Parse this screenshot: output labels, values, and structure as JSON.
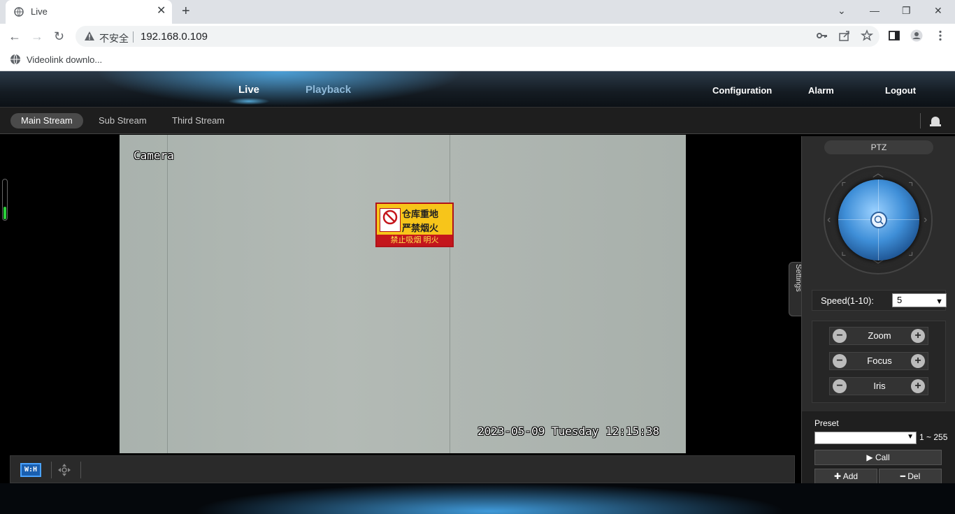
{
  "browser": {
    "tab_title": "Live",
    "tab_close": "✕",
    "new_tab": "+",
    "window_controls": {
      "minimize": "—",
      "restore": "❐",
      "close": "✕",
      "tab_search": "⌄"
    },
    "security_label": "不安全",
    "url": "192.168.0.109",
    "bookmark_label": "Videolink downlo..."
  },
  "app": {
    "nav": {
      "live": "Live",
      "playback": "Playback",
      "configuration": "Configuration",
      "alarm": "Alarm",
      "logout": "Logout"
    },
    "streams": [
      "Main Stream",
      "Sub Stream",
      "Third Stream"
    ],
    "video": {
      "osd_name": "Camera",
      "osd_time": "2023-05-09 Tuesday 12:15:38",
      "sign": {
        "line1": "仓库重地",
        "line2": "严禁烟火",
        "line3": "禁止吸烟 明火"
      }
    },
    "toolbar": {
      "wh_label": "W:H"
    },
    "ptz": {
      "title": "PTZ",
      "side_tab": "PTZ Settings",
      "speed_label": "Speed(1-10):",
      "speed_value": "5",
      "zoom": "Zoom",
      "focus": "Focus",
      "iris": "Iris",
      "preset_label": "Preset",
      "preset_range": "1 ~ 255",
      "call": "Call",
      "add": "Add",
      "del": "Del"
    }
  },
  "colors": {
    "accent": "#4aa3ff",
    "level_green": "#2bd03b"
  }
}
